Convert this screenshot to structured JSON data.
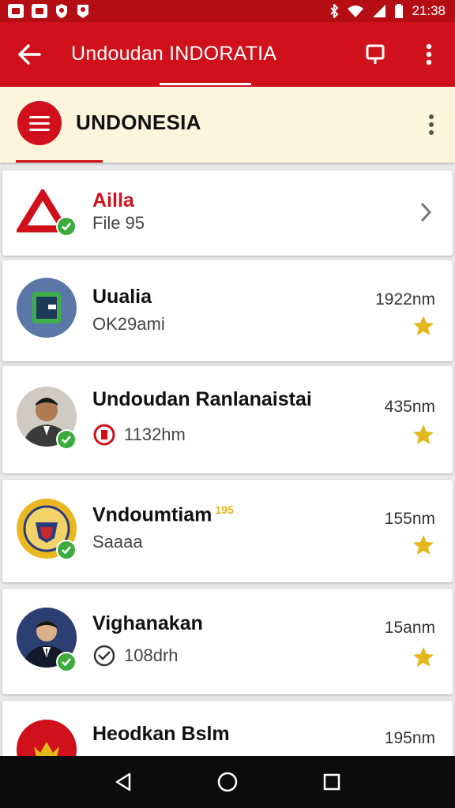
{
  "status_bar": {
    "time": "21:38",
    "icons": [
      "notification-icon",
      "image-icon",
      "shield-icon",
      "map-pin-icon",
      "bluetooth-icon",
      "wifi-icon",
      "signal-icon",
      "battery-icon"
    ]
  },
  "app_bar": {
    "title": "Undoudan INDORATIA",
    "back_icon": "arrow-left-icon",
    "actions": [
      "cast-icon",
      "more-vert-icon"
    ]
  },
  "sub_header": {
    "title": "UNDONESIA",
    "menu_icon": "hamburger-icon",
    "more_icon": "more-vert-icon"
  },
  "list": [
    {
      "name": "Ailla",
      "subtitle": "File 95",
      "distance": "",
      "verified": true,
      "trailing": "chevron-right-icon",
      "accent": "#d0111b"
    },
    {
      "name": "Uualia",
      "subtitle": "OK29ami",
      "distance": "1922nm",
      "verified": false,
      "trailing": "star-icon"
    },
    {
      "name": "Undoudan Ranlanaistai",
      "subtitle": "1132hm",
      "distance": "435nm",
      "verified": true,
      "trailing": "star-icon"
    },
    {
      "name": "Vndoumtiam",
      "name_badge": "195",
      "subtitle": "Saaaa",
      "distance": "155nm",
      "verified": true,
      "trailing": "star-icon"
    },
    {
      "name": "Vighanakan",
      "subtitle": "108drh",
      "distance": "15anm",
      "verified": true,
      "trailing": "star-icon"
    },
    {
      "name": "Heodkan Bslm",
      "subtitle": "",
      "distance": "195nm",
      "verified": false,
      "trailing": "star-icon"
    }
  ],
  "colors": {
    "primary": "#d0111b",
    "status_bar": "#b40d14",
    "header_bg": "#fbf5dc",
    "star": "#e2b81c",
    "verified": "#3cab3c"
  },
  "nav_bar": [
    "back-triangle-icon",
    "home-circle-icon",
    "recents-square-icon"
  ]
}
